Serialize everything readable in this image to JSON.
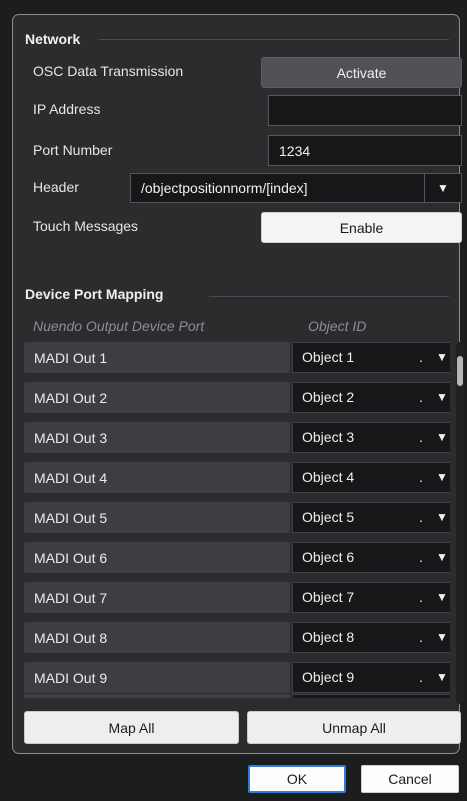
{
  "network": {
    "title": "Network",
    "osc_label": "OSC Data Transmission",
    "osc_button": "Activate",
    "ip_label": "IP Address",
    "ip_value": "",
    "port_label": "Port Number",
    "port_value": "1234",
    "header_label": "Header",
    "header_value": "/objectpositionnorm/[index]",
    "touch_label": "Touch Messages",
    "touch_button": "Enable"
  },
  "mapping": {
    "title": "Device Port Mapping",
    "col_port": "Nuendo Output Device Port",
    "col_object": "Object ID",
    "rows": [
      {
        "port": "MADI Out 1",
        "object": "Object 1"
      },
      {
        "port": "MADI Out 2",
        "object": "Object 2"
      },
      {
        "port": "MADI Out 3",
        "object": "Object 3"
      },
      {
        "port": "MADI Out 4",
        "object": "Object 4"
      },
      {
        "port": "MADI Out 5",
        "object": "Object 5"
      },
      {
        "port": "MADI Out 6",
        "object": "Object 6"
      },
      {
        "port": "MADI Out 7",
        "object": "Object 7"
      },
      {
        "port": "MADI Out 8",
        "object": "Object 8"
      },
      {
        "port": "MADI Out 9",
        "object": "Object 9"
      }
    ],
    "map_all": "Map All",
    "unmap_all": "Unmap All"
  },
  "footer": {
    "ok": "OK",
    "cancel": "Cancel"
  },
  "icons": {
    "dropdown": "▼"
  }
}
